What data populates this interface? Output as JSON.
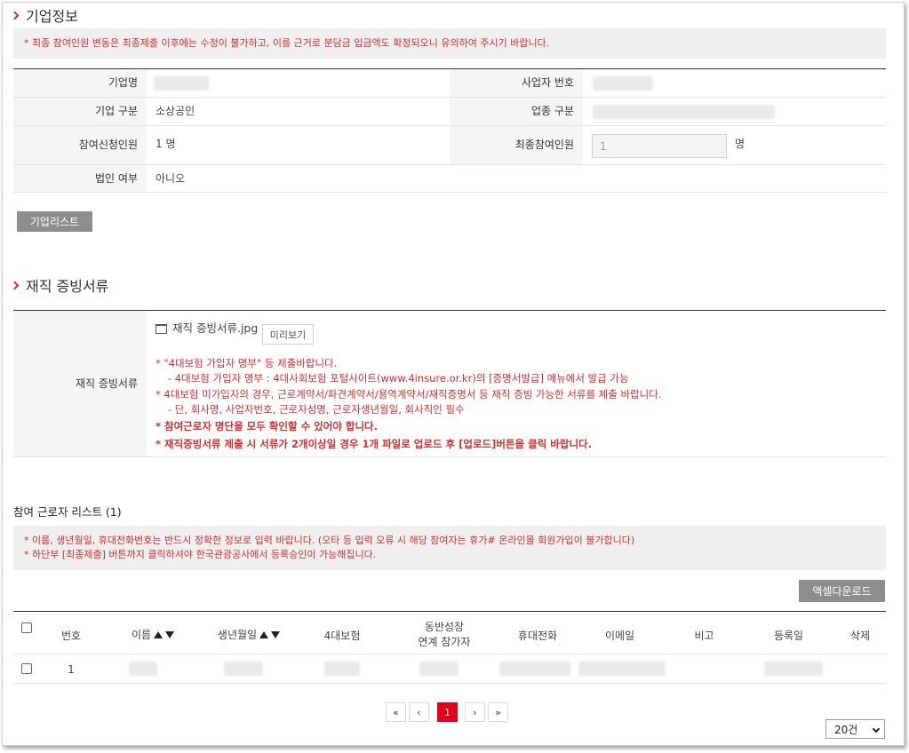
{
  "company_section": {
    "title": "기업정보",
    "notice": "* 최종 참여인원 변동은 최종제출 이후에는 수정이 불가하고, 이를 근거로 분담금 입금액도 확정되오니 유의하여 주시기 바랍니다.",
    "rows": {
      "company_name_label": "기업명",
      "business_no_label": "사업자 번호",
      "company_type_label": "기업 구분",
      "company_type_value": "소상공인",
      "industry_label": "업종 구분",
      "applicants_label": "참여신청인원",
      "applicants_value": "1 명",
      "final_label": "최종참여인원",
      "final_value": "1",
      "final_unit": "명",
      "corp_label": "법인 여부",
      "corp_value": "아니오"
    },
    "list_button": "기업리스트"
  },
  "docs_section": {
    "title": "재직 증빙서류",
    "label": "재직 증빙서류",
    "file_name": "재직 증빙서류.jpg",
    "preview_button": "미리보기",
    "lines": [
      {
        "text": "* \"4대보험 가입자 명부\" 등 제출바랍니다.",
        "bold": false
      },
      {
        "text": "- 4대보험 가입자 명부 : 4대사회보험 포털사이트(www.4insure.or.kr)의 [증명서발급] 메뉴에서 발급 가능",
        "bold": false
      },
      {
        "text": "* 4대보험 미가입자의 경우, 근로계약서/파견계약서/용역계약서/재직증명서 등 재직 증빙 가능한 서류를 제출 바랍니다.",
        "bold": false
      },
      {
        "text": "- 단, 회사명, 사업자번호, 근로자성명, 근로자생년월일, 회사직인 필수",
        "bold": false
      },
      {
        "text": "* 참여근로자 명단을 모두 확인할 수 있어야 합니다.",
        "bold": true
      },
      {
        "text": "* 재직증빙서류 제출 시 서류가 2개이상일 경우 1개 파일로 업로드 후 [업로드]버튼을 클릭 바랍니다.",
        "bold": true
      }
    ]
  },
  "workers_section": {
    "title": "참여 근로자 리스트 (1)",
    "notice_1": "* 이름, 생년월일, 휴대전화번호는 반드시 정확한 정보로 입력 바랍니다. (오타 등 입력 오류 시 해당 참여자는 휴가# 온라인몰 회원가입이 불가합니다)",
    "notice_2": "* 하단부 [최종제출] 버튼까지 클릭하셔야 한국관광공사에서 등록승인이 가능해집니다.",
    "excel_button": "액셀다운로드",
    "columns": {
      "no": "번호",
      "name": "이름",
      "birth": "생년월일",
      "insurance": "4대보험",
      "companion_1": "동반성장",
      "companion_2": "연계 참가자",
      "phone": "휴대전화",
      "email": "이메일",
      "note": "비고",
      "reg_date": "등록일",
      "delete": "삭제"
    },
    "rows": [
      {
        "no": "1"
      }
    ]
  },
  "pagination": {
    "first": "«",
    "prev": "‹",
    "current": "1",
    "next": "›",
    "last": "»"
  },
  "page_size": {
    "selected": "20건"
  },
  "colors": {
    "accent_red": "#d32f2f",
    "active_page": "#e0001b",
    "button_gray": "#8d8d8d"
  }
}
